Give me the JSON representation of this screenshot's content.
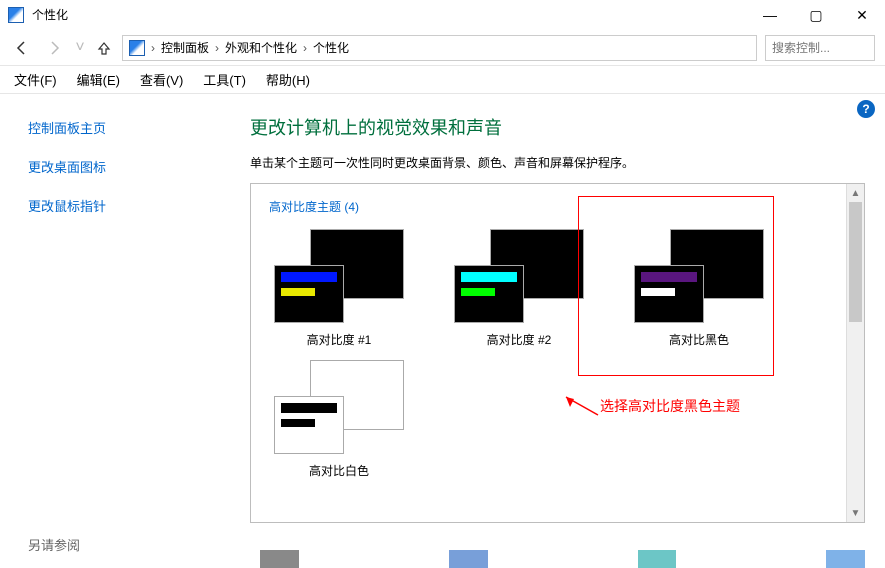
{
  "window": {
    "title": "个性化"
  },
  "breadcrumb": {
    "root": "控制面板",
    "group": "外观和个性化",
    "page": "个性化",
    "sep": "›"
  },
  "search": {
    "placeholder": "搜索控制..."
  },
  "menu": {
    "file": "文件(F)",
    "edit": "编辑(E)",
    "view": "查看(V)",
    "tools": "工具(T)",
    "help": "帮助(H)"
  },
  "sidebar": {
    "home": "控制面板主页",
    "desktop_icons": "更改桌面图标",
    "mouse_pointer": "更改鼠标指针",
    "see_also": "另请参阅"
  },
  "main": {
    "heading": "更改计算机上的视觉效果和声音",
    "desc": "单击某个主题可一次性同时更改桌面背景、颜色、声音和屏幕保护程序。",
    "section": "高对比度主题 (4)",
    "themes": {
      "hc1": "高对比度 #1",
      "hc2": "高对比度 #2",
      "hc_black": "高对比黑色",
      "hc_white": "高对比白色"
    }
  },
  "annotation": {
    "text": "选择高对比度黑色主题"
  },
  "help_glyph": "?"
}
